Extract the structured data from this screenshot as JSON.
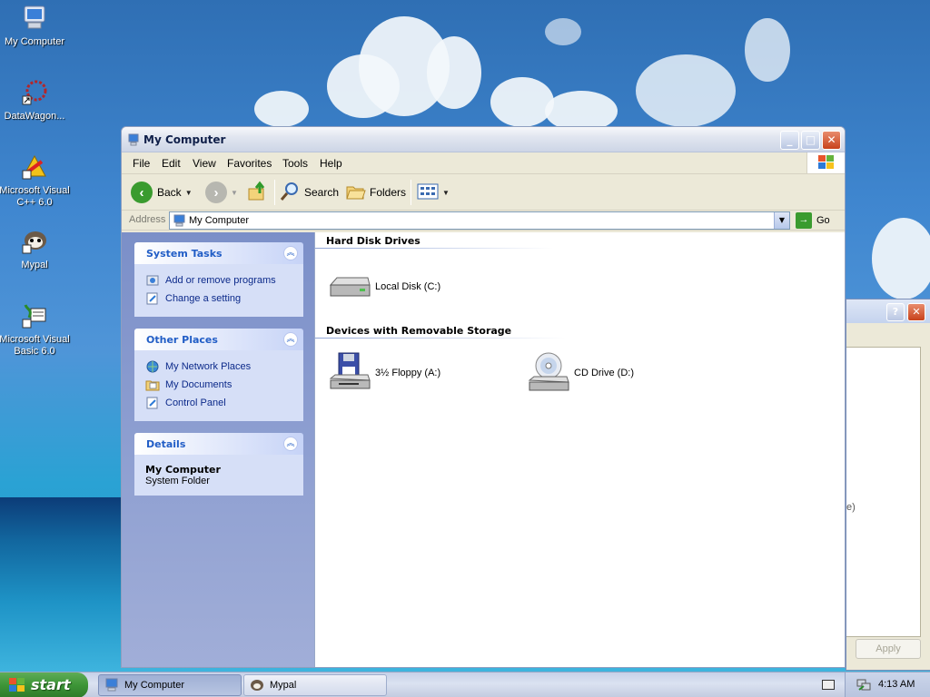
{
  "desktop": {
    "icons": [
      {
        "label": "My Computer"
      },
      {
        "label": "DataWagon..."
      },
      {
        "label": "Microsoft Visual C++ 6.0"
      },
      {
        "label": "Mypal"
      },
      {
        "label": "Microsoft Visual Basic 6.0"
      }
    ]
  },
  "window": {
    "title": "My Computer",
    "menu": [
      "File",
      "Edit",
      "View",
      "Favorites",
      "Tools",
      "Help"
    ],
    "toolbar": {
      "back_label": "Back",
      "search_label": "Search",
      "folders_label": "Folders"
    },
    "address": {
      "label": "Address",
      "value": "My Computer",
      "go_label": "Go"
    },
    "taskpane": {
      "system_tasks": {
        "title": "System Tasks",
        "items": [
          "Add or remove programs",
          "Change a setting"
        ]
      },
      "other_places": {
        "title": "Other Places",
        "items": [
          "My Network Places",
          "My Documents",
          "Control Panel"
        ]
      },
      "details": {
        "title": "Details",
        "name": "My Computer",
        "sub": "System Folder"
      }
    },
    "groups": {
      "hard_disk": {
        "title": "Hard Disk Drives",
        "items": [
          "Local Disk (C:)"
        ]
      },
      "removable": {
        "title": "Devices with Removable Storage",
        "items": [
          "3½ Floppy (A:)",
          "CD Drive (D:)"
        ]
      }
    }
  },
  "back_dialog": {
    "apply_label": "Apply",
    "fragments": [
      "e)"
    ]
  },
  "taskbar": {
    "start_label": "start",
    "items": [
      "My Computer",
      "Mypal"
    ],
    "clock": "4:13 AM"
  },
  "colors": {
    "link_blue": "#0c2a8a",
    "panel_title": "#215dc6",
    "start_green": "#3d9537"
  }
}
